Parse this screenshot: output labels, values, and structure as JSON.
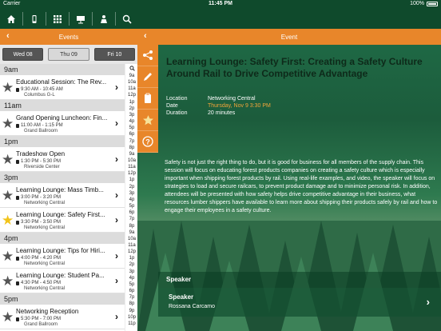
{
  "status_bar": {
    "carrier": "Carrier",
    "time": "11:45 PM",
    "battery": "100%"
  },
  "top_nav": {
    "icons": [
      "home-icon",
      "phone-icon",
      "grid-icon",
      "presentation-icon",
      "person-icon",
      "search-icon"
    ]
  },
  "events_panel": {
    "title": "Events",
    "back": "‹",
    "days": [
      {
        "label": "Wed 08",
        "style": "dark"
      },
      {
        "label": "Thu 09",
        "style": "light"
      },
      {
        "label": "Fri 10",
        "style": "dark"
      }
    ],
    "time_index": [
      "9a",
      "10a",
      "11a",
      "12p",
      "1p",
      "2p",
      "3p",
      "4p",
      "5p",
      "6p",
      "7p",
      "8p",
      "9a",
      "10a",
      "11a",
      "12p",
      "1p",
      "2p",
      "3p",
      "4p",
      "5p",
      "6p",
      "7p",
      "8p",
      "9a",
      "10a",
      "11a",
      "12p",
      "1p",
      "2p",
      "3p",
      "4p",
      "5p",
      "6p",
      "7p",
      "8p",
      "9p",
      "10p",
      "11p"
    ],
    "sections": [
      {
        "hour": "9am",
        "events": [
          {
            "title": "Educational Session: The Rev...",
            "time": "9:30 AM - 10:45 AM",
            "location": "Columbus G-L",
            "favorite": false
          }
        ]
      },
      {
        "hour": "11am",
        "events": [
          {
            "title": "Grand Opening Luncheon: Fin...",
            "time": "11:00 AM - 1:15 PM",
            "location": "Grand Ballroom",
            "favorite": false
          }
        ]
      },
      {
        "hour": "1pm",
        "events": [
          {
            "title": "Tradeshow Open",
            "time": "1:30 PM - 5:30 PM",
            "location": "Riverside Center",
            "favorite": false
          }
        ]
      },
      {
        "hour": "3pm",
        "events": [
          {
            "title": "Learning Lounge: Mass Timb...",
            "time": "3:00 PM - 3:20 PM",
            "location": "Networking Central",
            "favorite": false
          },
          {
            "title": "Learning Lounge: Safety First...",
            "time": "3:30 PM - 3:50 PM",
            "location": "Networking Central",
            "favorite": true
          }
        ]
      },
      {
        "hour": "4pm",
        "events": [
          {
            "title": "Learning Lounge: Tips for Hiri...",
            "time": "4:00 PM - 4:20 PM",
            "location": "Networking Central",
            "favorite": false
          },
          {
            "title": "Learning Lounge: Student Pa...",
            "time": "4:30 PM - 4:50 PM",
            "location": "Networking Central",
            "favorite": false
          }
        ]
      },
      {
        "hour": "5pm",
        "events": [
          {
            "title": "Networking Reception",
            "time": "5:30 PM - 7:00 PM",
            "location": "Grand Ballroom",
            "favorite": false
          }
        ]
      }
    ]
  },
  "actions": [
    {
      "icon": "share-icon",
      "glyph": "⋈"
    },
    {
      "icon": "pencil-icon",
      "glyph": "✎"
    },
    {
      "icon": "clipboard-icon",
      "glyph": "▤"
    },
    {
      "icon": "star-icon",
      "glyph": "★"
    },
    {
      "icon": "help-icon",
      "glyph": "?"
    }
  ],
  "event_panel": {
    "title": "Event",
    "back": "‹",
    "event_title": "Learning Lounge: Safety First: Creating a Safety Culture Around Rail to Drive Competitive Advantage",
    "location_label": "Location",
    "location_value": "Networking Central",
    "date_label": "Date",
    "date_value": "Thursday, Nov 9 3:30 PM",
    "duration_label": "Duration",
    "duration_value": "20 minutes",
    "description": "Safety is not just the right thing to do, but it is good for business for all members of the supply chain. This session will focus on educating forest products companies on creating a safety culture which is especially important when shipping forest products by rail. Using real-life examples, and video, the speaker will focus on strategies to load and secure railcars, to prevent product damage and to minimize personal risk. In addition, attendees will be presented with how safety helps drive competitive advantage in their business, what resources lumber shippers have available to learn more about shipping their products safely by rail and how to engage their employees in a safety culture.",
    "speaker_section": "Speaker",
    "speaker_label": "Speaker",
    "speaker_name": "Rossana Carcamo"
  },
  "colors": {
    "orange": "#e8862a",
    "dark_green": "#0f4a2c",
    "favorite": "#f2c41a",
    "date_orange": "#f2a53a"
  }
}
